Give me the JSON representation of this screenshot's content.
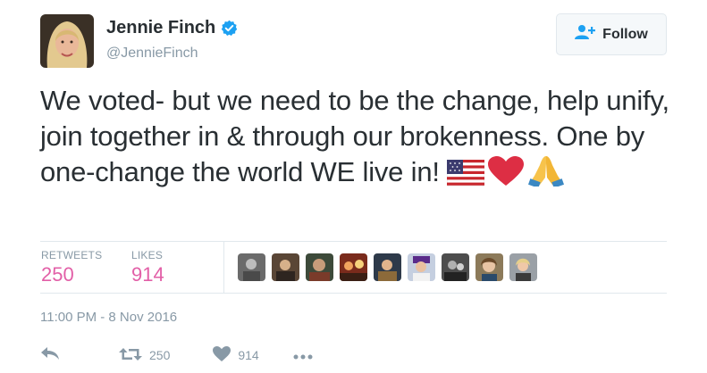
{
  "author": {
    "name": "Jennie Finch",
    "handle": "@JennieFinch",
    "verified": true
  },
  "follow_button": {
    "label": "Follow"
  },
  "tweet": {
    "text": "We voted- but we need to be the change, help unify, join together in & through our brokenness. One by one-change the world WE live in!",
    "emojis": [
      "us-flag",
      "red-heart",
      "folded-hands"
    ]
  },
  "stats": {
    "retweets_label": "RETWEETS",
    "retweets_value": "250",
    "likes_label": "LIKES",
    "likes_value": "914"
  },
  "likers_count": 9,
  "timestamp": "11:00 PM - 8 Nov 2016",
  "actions": {
    "reply": "",
    "retweet_count": "250",
    "like_count": "914"
  },
  "colors": {
    "accent_pink": "#e25fa7",
    "muted": "#8899a6",
    "verified_blue": "#1da1f2",
    "follow_icon_blue": "#1da1f2"
  }
}
